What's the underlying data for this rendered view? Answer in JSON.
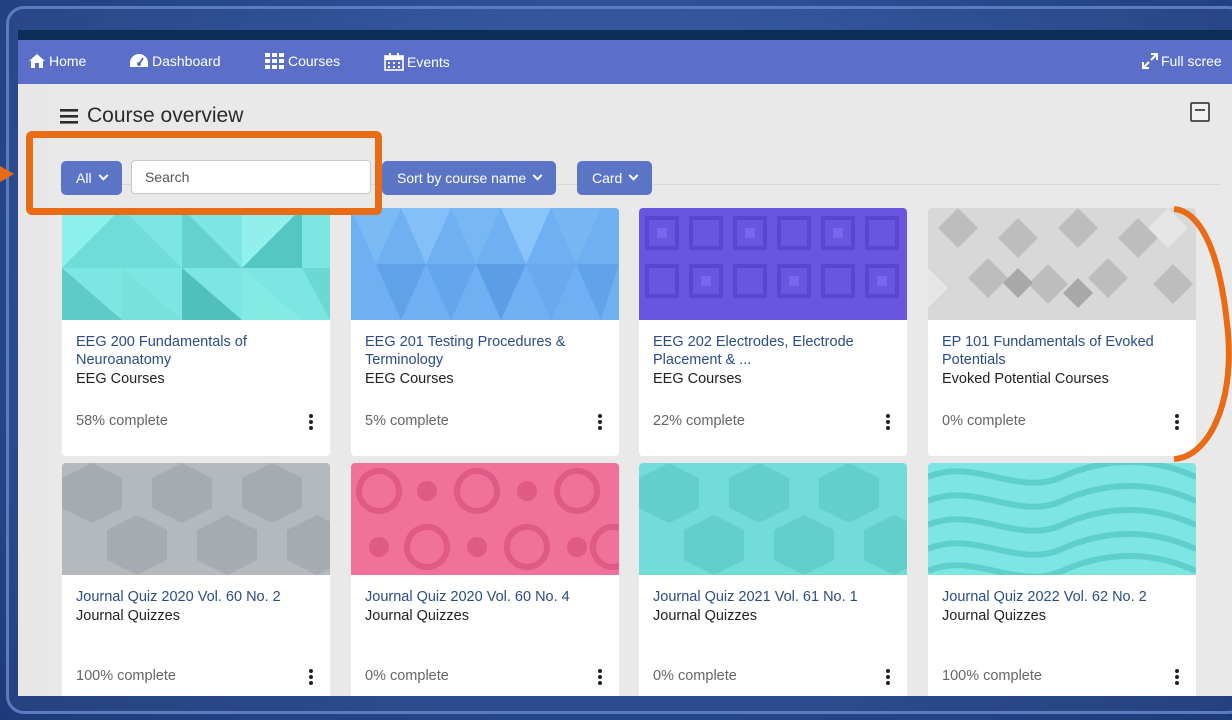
{
  "navbar": {
    "items": [
      {
        "label": "Home",
        "icon": "home-icon"
      },
      {
        "label": "Dashboard",
        "icon": "dashboard-icon"
      },
      {
        "label": "Courses",
        "icon": "grid-icon"
      },
      {
        "label": "Events",
        "icon": "calendar-icon"
      }
    ],
    "fullscreen_label": "Full scree"
  },
  "panel": {
    "title": "Course overview"
  },
  "filters": {
    "grouping_label": "All",
    "search_placeholder": "Search",
    "sort_label": "Sort by course name",
    "view_label": "Card"
  },
  "colors": {
    "accent": "#5c74c6",
    "highlight": "#ea6b16",
    "title_link": "#2b4c85"
  },
  "courses": [
    {
      "title": "EEG 200 Fundamentals of Neuroanatomy",
      "category": "EEG Courses",
      "progress": "58% complete",
      "pattern": "teal-triangles"
    },
    {
      "title": "EEG 201 Testing Procedures & Terminology",
      "category": "EEG Courses",
      "progress": "5% complete",
      "pattern": "blue-triangles"
    },
    {
      "title": "EEG 202 Electrodes, Electrode Placement & ...",
      "category": "EEG Courses",
      "progress": "22% complete",
      "pattern": "purple-squares"
    },
    {
      "title": "EP 101 Fundamentals of Evoked Potentials",
      "category": "Evoked Potential Courses",
      "progress": "0% complete",
      "pattern": "gray-diamonds"
    },
    {
      "title": "Journal Quiz 2020 Vol. 60 No. 2",
      "category": "Journal Quizzes",
      "progress": "100% complete",
      "pattern": "gray-hexagons"
    },
    {
      "title": "Journal Quiz 2020 Vol. 60 No. 4",
      "category": "Journal Quizzes",
      "progress": "0% complete",
      "pattern": "pink-circles"
    },
    {
      "title": "Journal Quiz 2021 Vol. 61 No. 1",
      "category": "Journal Quizzes",
      "progress": "0% complete",
      "pattern": "teal-hexagons"
    },
    {
      "title": "Journal Quiz 2022 Vol. 62 No. 2",
      "category": "Journal Quizzes",
      "progress": "100% complete",
      "pattern": "teal-waves"
    }
  ]
}
